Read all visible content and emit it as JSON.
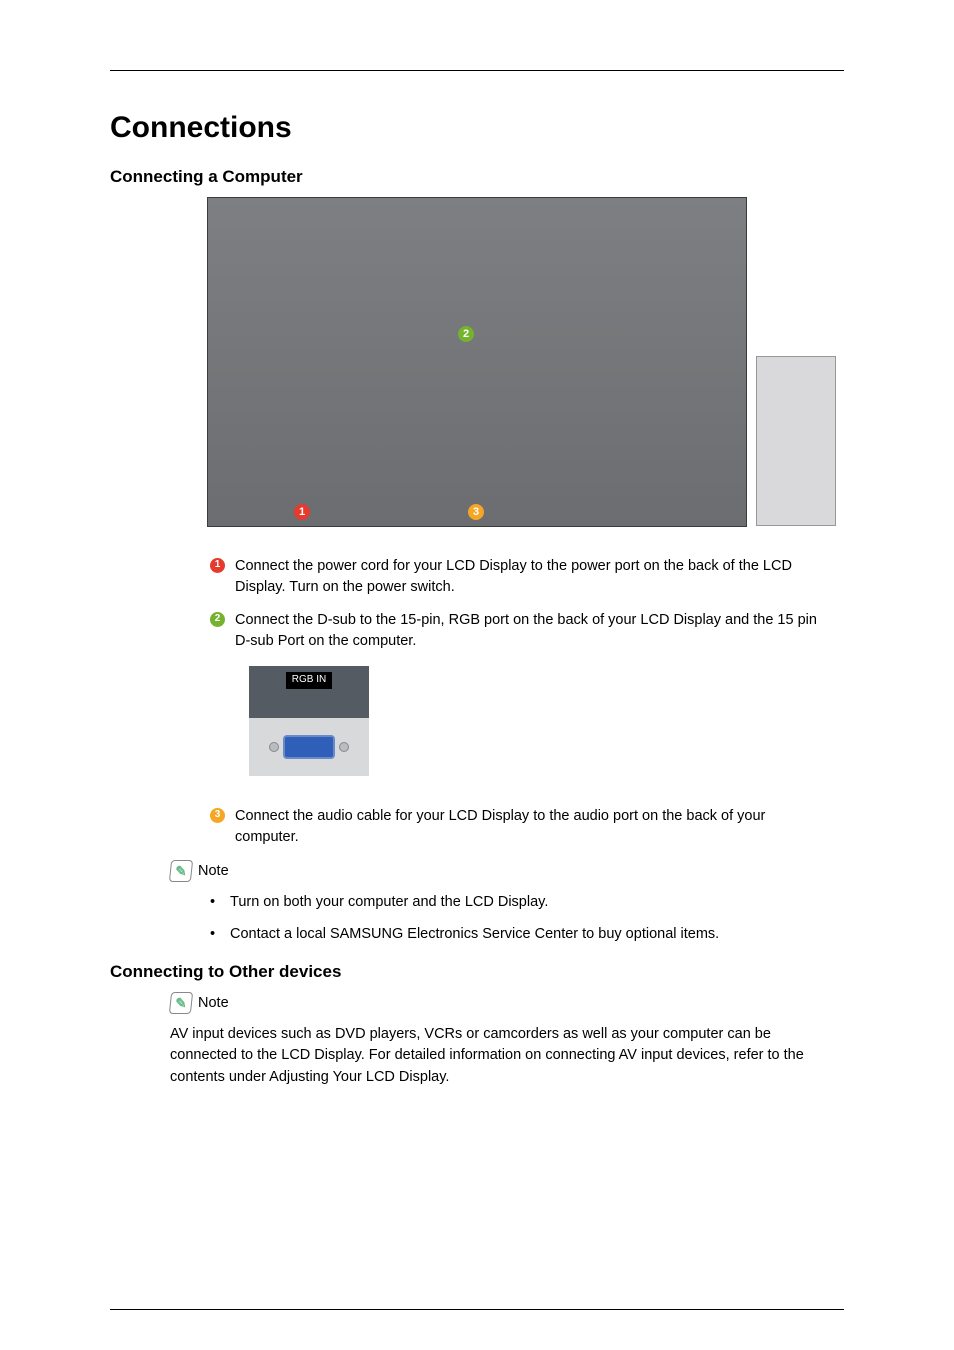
{
  "title": "Connections",
  "section1": {
    "heading": "Connecting a Computer",
    "steps": {
      "s1": "Connect the power cord for your LCD Display to the power port on the back of the LCD Display. Turn on the power switch.",
      "s2": "Connect the D-sub to the 15-pin, RGB port on the back of your LCD Display and the 15 pin D-sub Port on the computer.",
      "s3": "Connect the audio cable for your LCD Display to the audio port on the back of your computer."
    },
    "rgb_label": "RGB IN",
    "note_label": "Note",
    "bullets": {
      "b1": "Turn on both your computer and the LCD Display.",
      "b2": "Contact a local SAMSUNG Electronics Service Center to buy optional items."
    }
  },
  "section2": {
    "heading": "Connecting to Other devices",
    "note_label": "Note",
    "paragraph": "AV input devices such as DVD players, VCRs or camcorders as well as your computer can be connected to the LCD Display. For detailed information on connecting AV input devices, refer to the contents under Adjusting Your LCD Display."
  }
}
